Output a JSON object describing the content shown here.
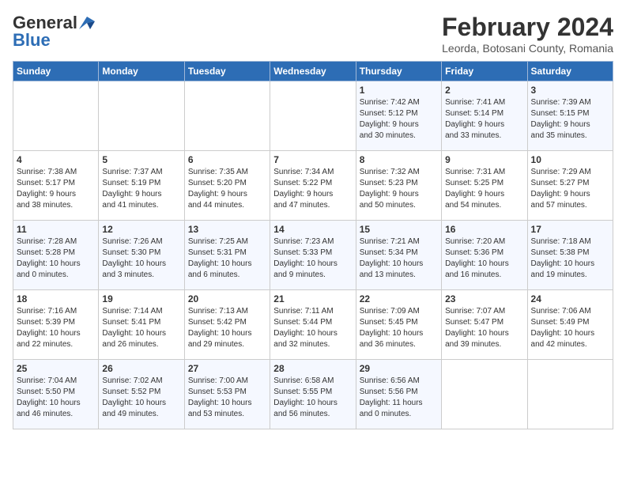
{
  "header": {
    "logo_general": "General",
    "logo_blue": "Blue",
    "month": "February 2024",
    "location": "Leorda, Botosani County, Romania"
  },
  "weekdays": [
    "Sunday",
    "Monday",
    "Tuesday",
    "Wednesday",
    "Thursday",
    "Friday",
    "Saturday"
  ],
  "weeks": [
    [
      {
        "day": "",
        "info": ""
      },
      {
        "day": "",
        "info": ""
      },
      {
        "day": "",
        "info": ""
      },
      {
        "day": "",
        "info": ""
      },
      {
        "day": "1",
        "info": "Sunrise: 7:42 AM\nSunset: 5:12 PM\nDaylight: 9 hours\nand 30 minutes."
      },
      {
        "day": "2",
        "info": "Sunrise: 7:41 AM\nSunset: 5:14 PM\nDaylight: 9 hours\nand 33 minutes."
      },
      {
        "day": "3",
        "info": "Sunrise: 7:39 AM\nSunset: 5:15 PM\nDaylight: 9 hours\nand 35 minutes."
      }
    ],
    [
      {
        "day": "4",
        "info": "Sunrise: 7:38 AM\nSunset: 5:17 PM\nDaylight: 9 hours\nand 38 minutes."
      },
      {
        "day": "5",
        "info": "Sunrise: 7:37 AM\nSunset: 5:19 PM\nDaylight: 9 hours\nand 41 minutes."
      },
      {
        "day": "6",
        "info": "Sunrise: 7:35 AM\nSunset: 5:20 PM\nDaylight: 9 hours\nand 44 minutes."
      },
      {
        "day": "7",
        "info": "Sunrise: 7:34 AM\nSunset: 5:22 PM\nDaylight: 9 hours\nand 47 minutes."
      },
      {
        "day": "8",
        "info": "Sunrise: 7:32 AM\nSunset: 5:23 PM\nDaylight: 9 hours\nand 50 minutes."
      },
      {
        "day": "9",
        "info": "Sunrise: 7:31 AM\nSunset: 5:25 PM\nDaylight: 9 hours\nand 54 minutes."
      },
      {
        "day": "10",
        "info": "Sunrise: 7:29 AM\nSunset: 5:27 PM\nDaylight: 9 hours\nand 57 minutes."
      }
    ],
    [
      {
        "day": "11",
        "info": "Sunrise: 7:28 AM\nSunset: 5:28 PM\nDaylight: 10 hours\nand 0 minutes."
      },
      {
        "day": "12",
        "info": "Sunrise: 7:26 AM\nSunset: 5:30 PM\nDaylight: 10 hours\nand 3 minutes."
      },
      {
        "day": "13",
        "info": "Sunrise: 7:25 AM\nSunset: 5:31 PM\nDaylight: 10 hours\nand 6 minutes."
      },
      {
        "day": "14",
        "info": "Sunrise: 7:23 AM\nSunset: 5:33 PM\nDaylight: 10 hours\nand 9 minutes."
      },
      {
        "day": "15",
        "info": "Sunrise: 7:21 AM\nSunset: 5:34 PM\nDaylight: 10 hours\nand 13 minutes."
      },
      {
        "day": "16",
        "info": "Sunrise: 7:20 AM\nSunset: 5:36 PM\nDaylight: 10 hours\nand 16 minutes."
      },
      {
        "day": "17",
        "info": "Sunrise: 7:18 AM\nSunset: 5:38 PM\nDaylight: 10 hours\nand 19 minutes."
      }
    ],
    [
      {
        "day": "18",
        "info": "Sunrise: 7:16 AM\nSunset: 5:39 PM\nDaylight: 10 hours\nand 22 minutes."
      },
      {
        "day": "19",
        "info": "Sunrise: 7:14 AM\nSunset: 5:41 PM\nDaylight: 10 hours\nand 26 minutes."
      },
      {
        "day": "20",
        "info": "Sunrise: 7:13 AM\nSunset: 5:42 PM\nDaylight: 10 hours\nand 29 minutes."
      },
      {
        "day": "21",
        "info": "Sunrise: 7:11 AM\nSunset: 5:44 PM\nDaylight: 10 hours\nand 32 minutes."
      },
      {
        "day": "22",
        "info": "Sunrise: 7:09 AM\nSunset: 5:45 PM\nDaylight: 10 hours\nand 36 minutes."
      },
      {
        "day": "23",
        "info": "Sunrise: 7:07 AM\nSunset: 5:47 PM\nDaylight: 10 hours\nand 39 minutes."
      },
      {
        "day": "24",
        "info": "Sunrise: 7:06 AM\nSunset: 5:49 PM\nDaylight: 10 hours\nand 42 minutes."
      }
    ],
    [
      {
        "day": "25",
        "info": "Sunrise: 7:04 AM\nSunset: 5:50 PM\nDaylight: 10 hours\nand 46 minutes."
      },
      {
        "day": "26",
        "info": "Sunrise: 7:02 AM\nSunset: 5:52 PM\nDaylight: 10 hours\nand 49 minutes."
      },
      {
        "day": "27",
        "info": "Sunrise: 7:00 AM\nSunset: 5:53 PM\nDaylight: 10 hours\nand 53 minutes."
      },
      {
        "day": "28",
        "info": "Sunrise: 6:58 AM\nSunset: 5:55 PM\nDaylight: 10 hours\nand 56 minutes."
      },
      {
        "day": "29",
        "info": "Sunrise: 6:56 AM\nSunset: 5:56 PM\nDaylight: 11 hours\nand 0 minutes."
      },
      {
        "day": "",
        "info": ""
      },
      {
        "day": "",
        "info": ""
      }
    ]
  ]
}
